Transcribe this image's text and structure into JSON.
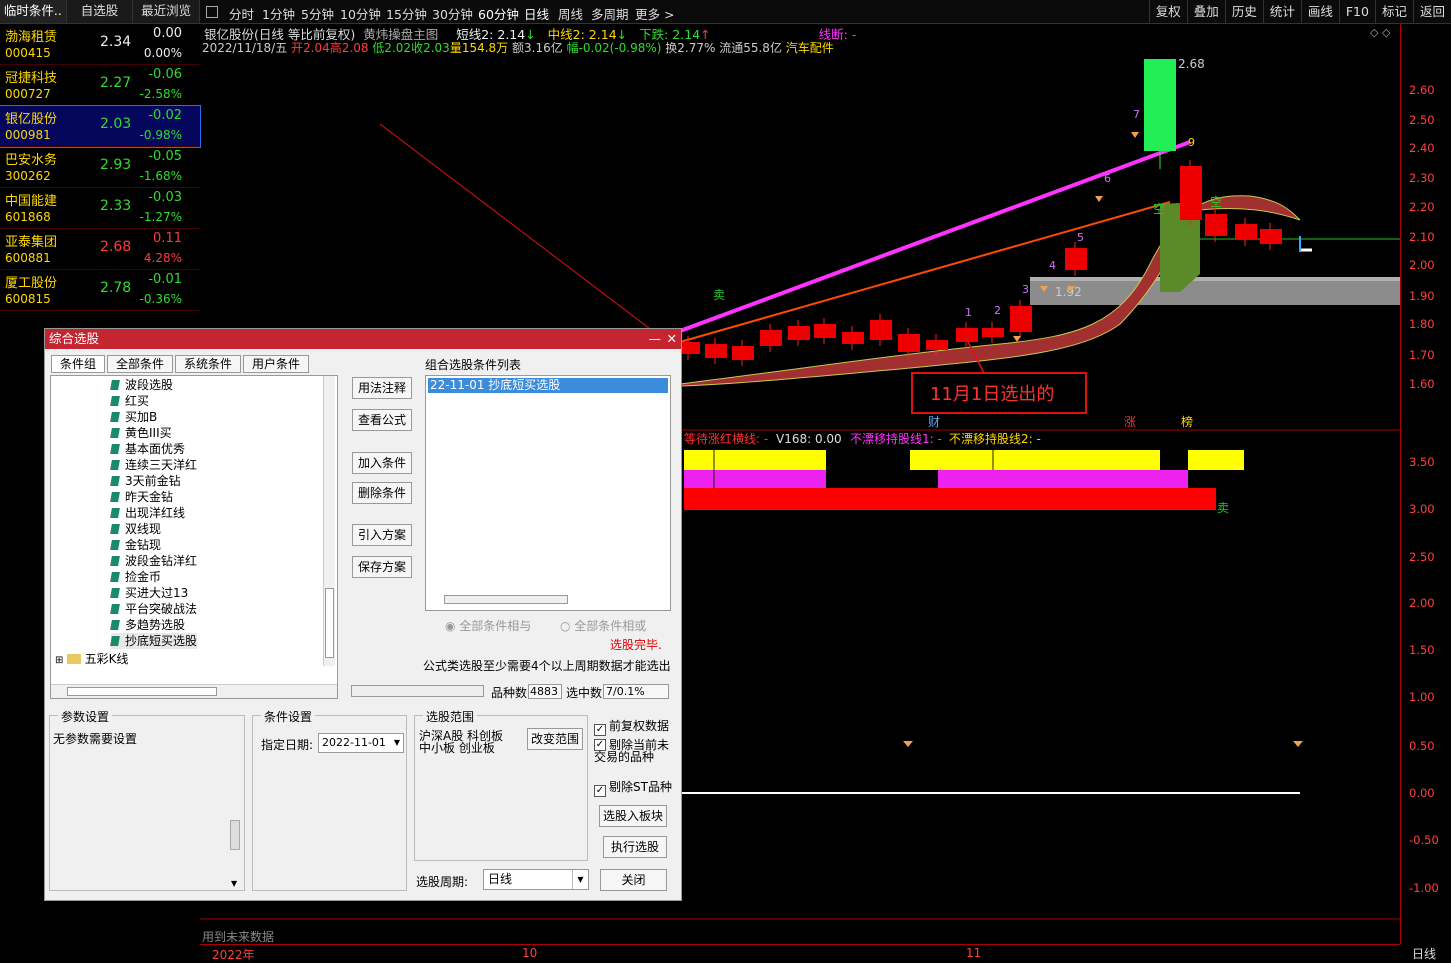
{
  "left_tabs": [
    "临时条件..",
    "自选股",
    "最近浏览"
  ],
  "stocks": [
    {
      "name": "渤海租赁",
      "code": "000415",
      "price": "2.34",
      "change": "0.00",
      "pct": "0.00%",
      "dir": "white"
    },
    {
      "name": "冠捷科技",
      "code": "000727",
      "price": "2.27",
      "change": "-0.06",
      "pct": "-2.58%",
      "dir": "green"
    },
    {
      "name": "银亿股份",
      "code": "000981",
      "price": "2.03",
      "change": "-0.02",
      "pct": "-0.98%",
      "dir": "green"
    },
    {
      "name": "巴安水务",
      "code": "300262",
      "price": "2.93",
      "change": "-0.05",
      "pct": "-1.68%",
      "dir": "green"
    },
    {
      "name": "中国能建",
      "code": "601868",
      "price": "2.33",
      "change": "-0.03",
      "pct": "-1.27%",
      "dir": "green"
    },
    {
      "name": "亚泰集团",
      "code": "600881",
      "price": "2.68",
      "change": "0.11",
      "pct": "4.28%",
      "dir": "red"
    },
    {
      "name": "厦工股份",
      "code": "600815",
      "price": "2.78",
      "change": "-0.01",
      "pct": "-0.36%",
      "dir": "green"
    }
  ],
  "periods": [
    "分时",
    "1分钟",
    "5分钟",
    "10分钟",
    "15分钟",
    "30分钟",
    "60分钟",
    "日线",
    "周线",
    "多周期",
    "更多 >"
  ],
  "right_tools": [
    "复权",
    "叠加",
    "历史",
    "统计",
    "画线",
    "F10",
    "标记",
    "返回"
  ],
  "info": {
    "title": "银亿股份(日线 等比前复权)",
    "indicator": "黄炜操盘主图",
    "short": "短线2: 2.14",
    "mid": "中线2: 2.14",
    "down": "下跌: 2.14",
    "line": "线断: -",
    "date": "2022/11/18/五",
    "open": "开2.04",
    "high": "高2.08",
    "low": "低2.02",
    "close": "收2.03",
    "vol": "量154.8万",
    "amt": "额3.16亿",
    "amp": "幅-0.02(-0.98%)",
    "turn": "换2.77%",
    "float": "流通55.8亿",
    "sector": "汽车配件"
  },
  "price_ticks": [
    "2.60",
    "2.50",
    "2.40",
    "2.30",
    "2.20",
    "2.10",
    "2.00",
    "1.90",
    "1.80",
    "1.70",
    "1.60"
  ],
  "sub_ticks": [
    "3.50",
    "3.00",
    "2.50",
    "2.00",
    "1.50",
    "1.00",
    "0.50",
    "0.00",
    "-0.50",
    "-1.00"
  ],
  "sub_info": {
    "a": "等待涨红横线: -",
    "b": "V168: 0.00",
    "c": "不漂移持股线1: -",
    "d": "不漂移持股线2: -"
  },
  "labels": {
    "high": "2.68",
    "low": "1.92",
    "annot": "11月1日选出的",
    "sell": "卖",
    "kong": "空",
    "cai": "财",
    "zhang": "涨",
    "bang": "榜",
    "future": "用到未来数据",
    "year": "2022年",
    "m10": "10",
    "m11": "11",
    "daily": "日线"
  },
  "counts": [
    "1",
    "2",
    "3",
    "4",
    "5",
    "6",
    "7",
    "9"
  ],
  "dialog": {
    "title": "综合选股",
    "tabs": [
      "条件组",
      "全部条件",
      "系统条件",
      "用户条件"
    ],
    "tree": [
      "波段选股",
      "红买",
      "买加B",
      "黄色III买",
      "基本面优秀",
      "连续三天洋红",
      "3天前金钻",
      "昨天金钻",
      "出现洋红线",
      "双线现",
      "金钻现",
      "波段金钻洋红",
      "捡金币",
      "买进大过13",
      "平台突破战法",
      "多趋势选股",
      "抄底短买选股"
    ],
    "tree_folder": "五彩K线",
    "buttons": [
      "用法注释",
      "查看公式",
      "加入条件",
      "删除条件",
      "引入方案",
      "保存方案"
    ],
    "list_title": "组合选股条件列表",
    "list_item": "22-11-01 抄底短买选股",
    "radio_and": "全部条件相与",
    "radio_or": "全部条件相或",
    "status": "选股完毕.",
    "note": "公式类选股至少需要4个以上周期数据才能选出",
    "count_label": "品种数",
    "count_val": "4883",
    "sel_label": "选中数",
    "sel_val": "7/0.1%",
    "param_title": "参数设置",
    "param_text": "无参数需要设置",
    "cond_title": "条件设置",
    "date_label": "指定日期:",
    "date_val": "2022-11-01",
    "range_title": "选股范围",
    "range_text": "沪深A股 科创板 中小板 创业板",
    "range_btn": "改变范围",
    "chk1": "前复权数据",
    "chk2": "剔除当前未交易的品种",
    "chk3": "剔除ST品种",
    "btn_block": "选股入板块",
    "btn_run": "执行选股",
    "btn_close": "关闭",
    "period_label": "选股周期:",
    "period_val": "日线"
  }
}
